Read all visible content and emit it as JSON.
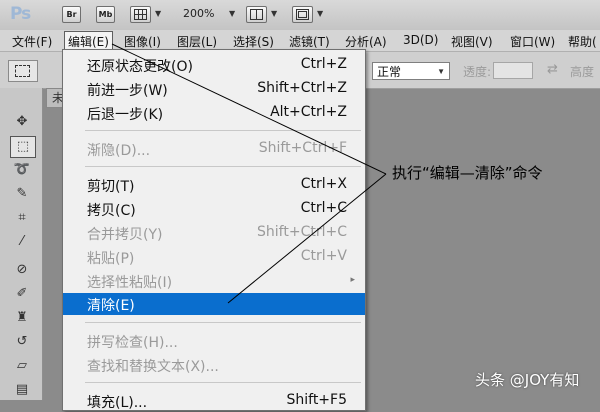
{
  "app": {
    "logo": "Ps"
  },
  "toolbar": {
    "bridge_label": "Br",
    "minibridge_label": "Mb",
    "zoom_value": "200%",
    "icons": [
      "grid-icon",
      "layout-icon",
      "screen-mode-icon"
    ]
  },
  "menubar": {
    "items": [
      {
        "label": "文件(F)"
      },
      {
        "label": "编辑(E)"
      },
      {
        "label": "图像(I)"
      },
      {
        "label": "图层(L)"
      },
      {
        "label": "选择(S)"
      },
      {
        "label": "滤镜(T)"
      },
      {
        "label": "分析(A)"
      },
      {
        "label": "3D(D)"
      },
      {
        "label": "视图(V)"
      },
      {
        "label": "窗口(W)"
      },
      {
        "label": "帮助("
      }
    ]
  },
  "options_bar": {
    "blend_mode": "正常",
    "opacity_label": "透度:",
    "height_label": "高度"
  },
  "document": {
    "tab_label": "未"
  },
  "edit_menu": {
    "items": [
      {
        "label": "还原状态更改(O)",
        "shortcut": "Ctrl+Z",
        "disabled": false
      },
      {
        "label": "前进一步(W)",
        "shortcut": "Shift+Ctrl+Z",
        "disabled": false
      },
      {
        "label": "后退一步(K)",
        "shortcut": "Alt+Ctrl+Z",
        "disabled": false
      },
      {
        "label": "渐隐(D)...",
        "shortcut": "Shift+Ctrl+F",
        "disabled": true
      },
      {
        "label": "剪切(T)",
        "shortcut": "Ctrl+X",
        "disabled": false
      },
      {
        "label": "拷贝(C)",
        "shortcut": "Ctrl+C",
        "disabled": false
      },
      {
        "label": "合并拷贝(Y)",
        "shortcut": "Shift+Ctrl+C",
        "disabled": true
      },
      {
        "label": "粘贴(P)",
        "shortcut": "Ctrl+V",
        "disabled": true
      },
      {
        "label": "选择性粘贴(I)",
        "shortcut": "",
        "disabled": true
      },
      {
        "label": "清除(E)",
        "shortcut": "",
        "disabled": false,
        "highlighted": true
      },
      {
        "label": "拼写检查(H)...",
        "shortcut": "",
        "disabled": true
      },
      {
        "label": "查找和替换文本(X)...",
        "shortcut": "",
        "disabled": true
      },
      {
        "label": "填充(L)...",
        "shortcut": "Shift+F5",
        "disabled": false
      }
    ]
  },
  "annotation": {
    "text": "执行“编辑—清除”命令"
  },
  "watermark": {
    "text": "头条 @JOY有知"
  },
  "colors": {
    "highlight": "#0a6ece",
    "menu_bg": "#f0f0f0",
    "canvas_bg": "#8b8b8b"
  }
}
